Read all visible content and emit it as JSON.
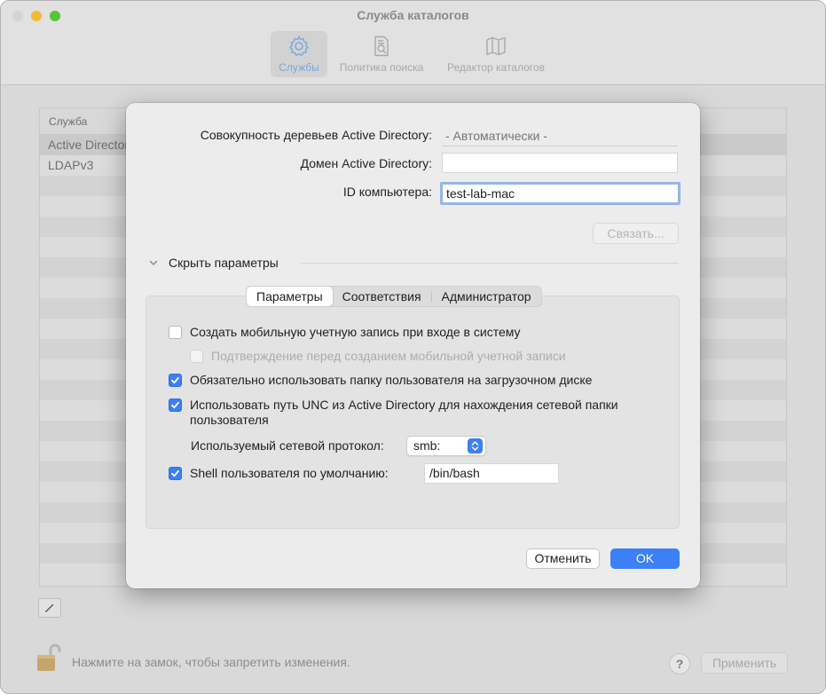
{
  "window": {
    "title": "Служба каталогов",
    "toolbar": [
      {
        "label": "Службы",
        "icon": "gear-icon",
        "selected": true
      },
      {
        "label": "Политика поиска",
        "icon": "search-policy-icon",
        "selected": false
      },
      {
        "label": "Редактор каталогов",
        "icon": "map-icon",
        "selected": false
      }
    ]
  },
  "service_list": {
    "header": "Служба",
    "rows": [
      "Active Directory",
      "LDAPv3"
    ]
  },
  "footer": {
    "lock_text": "Нажмите на замок, чтобы запретить изменения.",
    "help_label": "?",
    "apply_label": "Применить"
  },
  "dialog": {
    "forest_label": "Совокупность деревьев Active Directory:",
    "forest_placeholder": "- Автоматически -",
    "domain_label": "Домен Active Directory:",
    "domain_value": "",
    "computer_id_label": "ID компьютера:",
    "computer_id_value": "test-lab-mac",
    "bind_label": "Связать...",
    "disclosure_label": "Скрыть параметры",
    "tabs": [
      "Параметры",
      "Соответствия",
      "Администратор"
    ],
    "active_tab": "Параметры",
    "options": {
      "mobile_account": {
        "label": "Создать мобильную учетную запись при входе в систему",
        "checked": false
      },
      "confirm_mobile": {
        "label": "Подтверждение перед созданием мобильной учетной записи",
        "checked": false,
        "disabled": true
      },
      "local_home": {
        "label": "Обязательно использовать папку пользователя на загрузочном диске",
        "checked": true
      },
      "unc_path": {
        "label": "Использовать путь UNC из Active Directory для нахождения сетевой папки пользователя",
        "checked": true
      },
      "protocol_label": "Используемый сетевой протокол:",
      "protocol_value": "smb:",
      "default_shell": {
        "label": "Shell пользователя по умолчанию:",
        "checked": true,
        "value": "/bin/bash"
      }
    },
    "cancel_label": "Отменить",
    "ok_label": "OK"
  }
}
